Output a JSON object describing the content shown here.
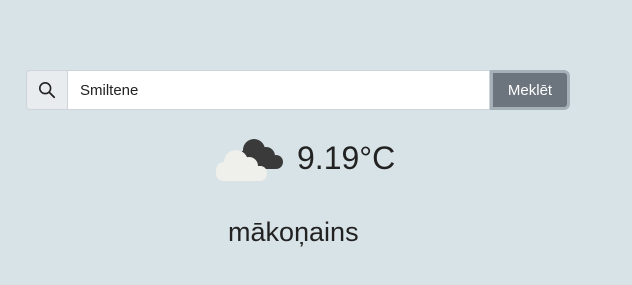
{
  "search": {
    "value": "Smiltene",
    "button_label": "Meklēt",
    "icon": "search-icon"
  },
  "weather": {
    "icon": "broken-clouds-icon",
    "temperature": "9.19°C",
    "description": "mākoņains"
  }
}
